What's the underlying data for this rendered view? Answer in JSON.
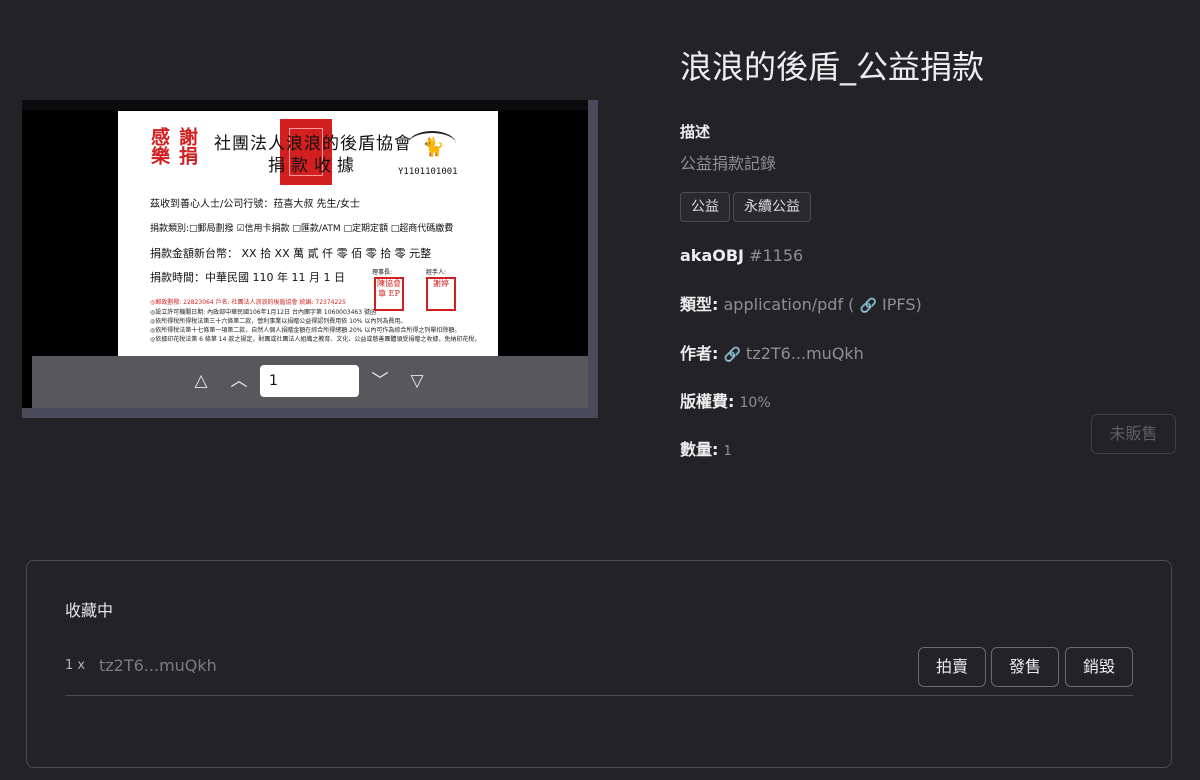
{
  "document": {
    "page_number_value": "1",
    "receipt": {
      "stamp_thanks": "謝捐",
      "stamp_joy": "感樂",
      "title": "社團法人浪浪的後盾協會",
      "subtitle": "捐款收據",
      "serial": "Y1101101001",
      "line_recipient": "茲收到善心人士/公司行號：菈喜大叔 先生/女士",
      "line_type": "捐款類別:□郵局劃撥 ☑信用卡捐款 □匯款/ATM □定期定額 □超商代碼繳費",
      "line_amount": "捐款金額新台幣： XX 拾 XX 萬 貳 仟 零 佰 零 拾 零 元整",
      "line_date": "捐款時間：中華民國 110 年 11 月 1 日",
      "label_chair": "理事長:",
      "label_handler": "經手人:",
      "sig_chair": "陳協會章 EP",
      "sig_handler": "謝婷",
      "red_note": "◎郵政劃撥: 22823064   戶名: 社團法人浪浪的後盾協會   統編: 72374225",
      "note1": "◎設立許可機關日期: 內政部中華民國106年1月12日 台內團字第 1060003463 號函",
      "note2": "◎依所得稅所得稅法第三十六條第二款，營利事業以捐贈公益得認列費用依 10% 以內列為費用。",
      "note3": "◎依所得稅法第十七條第一項第二款，自然人個人捐贈金額在綜合所得總額 20% 以內可作為綜合所得之列舉扣除額。",
      "note4": "◎依據印花稅法第 6 條第 14 款之規定，財團或社團法人組織之教育、文化、公益或慈善團體領受捐贈之收據，免納印花稅。"
    }
  },
  "item": {
    "title": "浪浪的後盾_公益捐款",
    "description_label": "描述",
    "description": "公益捐款記錄",
    "tags": [
      "公益",
      "永續公益"
    ],
    "collection_name": "akaOBJ",
    "token_id": "#1156",
    "type_label": "類型:",
    "type_value": "application/pdf (",
    "ipfs_label": "IPFS)",
    "author_label": "作者:",
    "author_value": "tz2T6...muQkh",
    "royalty_label": "版權費:",
    "royalty_value": "10%",
    "quantity_label": "數量:",
    "quantity_value": "1",
    "unsold_label": "未販售"
  },
  "collection_panel": {
    "title": "收藏中",
    "owner_qty": "1 x",
    "owner_address": "tz2T6...muQkh",
    "buttons": {
      "auction": "拍賣",
      "sell": "發售",
      "burn": "銷毀"
    }
  }
}
